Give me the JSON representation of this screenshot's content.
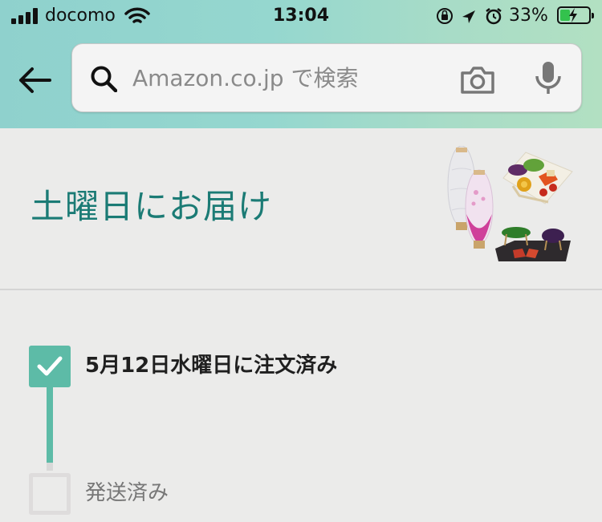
{
  "status_bar": {
    "carrier": "docomo",
    "time": "13:04",
    "battery_percent": "33%"
  },
  "search": {
    "placeholder": "Amazon.co.jp で検索"
  },
  "delivery": {
    "heading": "土曜日にお届け"
  },
  "tracker": {
    "steps": [
      {
        "label": "5月12日水曜日に注文済み",
        "completed": true
      },
      {
        "label": "発送済み",
        "completed": false
      }
    ]
  },
  "colors": {
    "accent": "#1b7b75",
    "progress": "#5dbba7"
  }
}
